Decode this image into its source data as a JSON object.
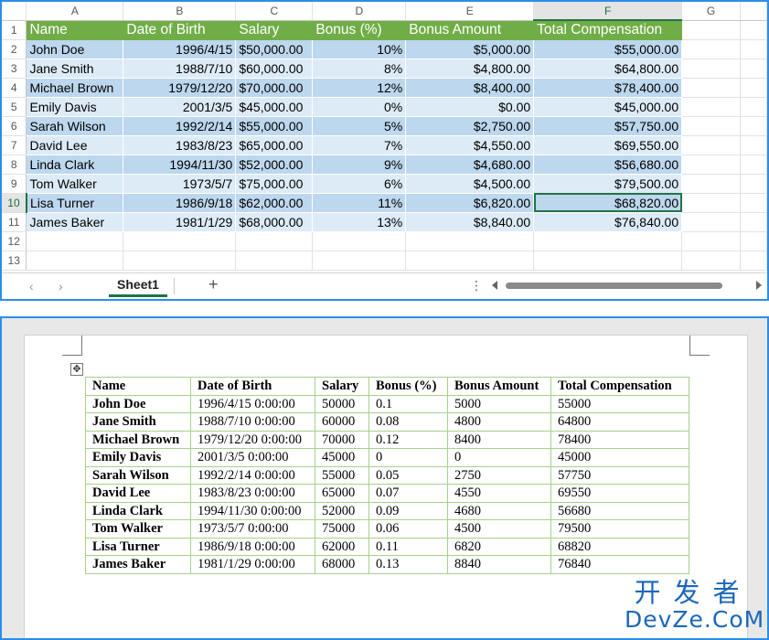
{
  "excel": {
    "columns": [
      "",
      "A",
      "B",
      "C",
      "D",
      "E",
      "F",
      "G"
    ],
    "row_numbers": [
      "1",
      "2",
      "3",
      "4",
      "5",
      "6",
      "7",
      "8",
      "9",
      "10",
      "11",
      "12",
      "13"
    ],
    "headers": [
      "Name",
      "Date of Birth",
      "Salary",
      "Bonus (%)",
      "Bonus Amount",
      "Total Compensation"
    ],
    "rows": [
      [
        "John Doe",
        "1996/4/15",
        "$50,000.00",
        "10%",
        "$5,000.00",
        "$55,000.00"
      ],
      [
        "Jane Smith",
        "1988/7/10",
        "$60,000.00",
        "8%",
        "$4,800.00",
        "$64,800.00"
      ],
      [
        "Michael Brown",
        "1979/12/20",
        "$70,000.00",
        "12%",
        "$8,400.00",
        "$78,400.00"
      ],
      [
        "Emily Davis",
        "2001/3/5",
        "$45,000.00",
        "0%",
        "$0.00",
        "$45,000.00"
      ],
      [
        "Sarah Wilson",
        "1992/2/14",
        "$55,000.00",
        "5%",
        "$2,750.00",
        "$57,750.00"
      ],
      [
        "David Lee",
        "1983/8/23",
        "$65,000.00",
        "7%",
        "$4,550.00",
        "$69,550.00"
      ],
      [
        "Linda Clark",
        "1994/11/30",
        "$52,000.00",
        "9%",
        "$4,680.00",
        "$56,680.00"
      ],
      [
        "Tom Walker",
        "1973/5/7",
        "$75,000.00",
        "6%",
        "$4,500.00",
        "$79,500.00"
      ],
      [
        "Lisa Turner",
        "1986/9/18",
        "$62,000.00",
        "11%",
        "$6,820.00",
        "$68,820.00"
      ],
      [
        "James Baker",
        "1981/1/29",
        "$68,000.00",
        "13%",
        "$8,840.00",
        "$76,840.00"
      ]
    ],
    "header_color": "#70ad47",
    "band_color_a": "#bdd7ee",
    "band_color_b": "#ddebf7",
    "sheet_tab": "Sheet1",
    "add_sheet": "+",
    "nav_prev": "‹",
    "nav_next": "›",
    "more": "⋮"
  },
  "word": {
    "headers": [
      "Name",
      "Date of Birth",
      "Salary",
      "Bonus (%)",
      "Bonus Amount",
      "Total Compensation"
    ],
    "rows": [
      [
        "John Doe",
        "1996/4/15 0:00:00",
        "50000",
        "0.1",
        "5000",
        "55000"
      ],
      [
        "Jane Smith",
        "1988/7/10 0:00:00",
        "60000",
        "0.08",
        "4800",
        "64800"
      ],
      [
        "Michael Brown",
        "1979/12/20 0:00:00",
        "70000",
        "0.12",
        "8400",
        "78400"
      ],
      [
        "Emily Davis",
        "2001/3/5 0:00:00",
        "45000",
        "0",
        "0",
        "45000"
      ],
      [
        "Sarah Wilson",
        "1992/2/14 0:00:00",
        "55000",
        "0.05",
        "2750",
        "57750"
      ],
      [
        "David Lee",
        "1983/8/23 0:00:00",
        "65000",
        "0.07",
        "4550",
        "69550"
      ],
      [
        "Linda Clark",
        "1994/11/30 0:00:00",
        "52000",
        "0.09",
        "4680",
        "56680"
      ],
      [
        "Tom Walker",
        "1973/5/7 0:00:00",
        "75000",
        "0.06",
        "4500",
        "79500"
      ],
      [
        "Lisa Turner",
        "1986/9/18 0:00:00",
        "62000",
        "0.11",
        "6820",
        "68820"
      ],
      [
        "James Baker",
        "1981/1/29 0:00:00",
        "68000",
        "0.13",
        "8840",
        "76840"
      ]
    ],
    "move_handle": "✥"
  },
  "watermark": {
    "cn": "开发者",
    "en": "DevZe.CoM"
  }
}
